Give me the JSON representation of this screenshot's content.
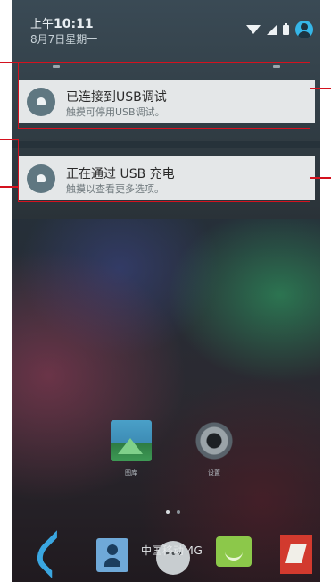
{
  "status_bar": {
    "time_prefix": "上午",
    "time": "10:11",
    "date": "8月7日星期一",
    "icons": [
      "wifi-icon",
      "cellular-signal-icon",
      "battery-icon",
      "user-account-icon"
    ]
  },
  "notifications": [
    {
      "icon": "android-debug-icon",
      "title": "已连接到USB调试",
      "subtitle": "触摸可停用USB调试。"
    },
    {
      "icon": "android-icon",
      "title": "正在通过 USB 充电",
      "subtitle": "触摸以查看更多选项。"
    }
  ],
  "home": {
    "apps": [
      {
        "label": "图库",
        "icon": "gallery-icon"
      },
      {
        "label": "设置",
        "icon": "settings-gear-icon"
      }
    ],
    "page_indicator": {
      "pages": 2,
      "active": 0
    },
    "carrier": "中国移动 4G",
    "dock": [
      "phone-icon",
      "contacts-icon",
      "all-apps-icon",
      "messaging-icon",
      "browser-icon"
    ]
  },
  "annotation_color": "#d4121f"
}
